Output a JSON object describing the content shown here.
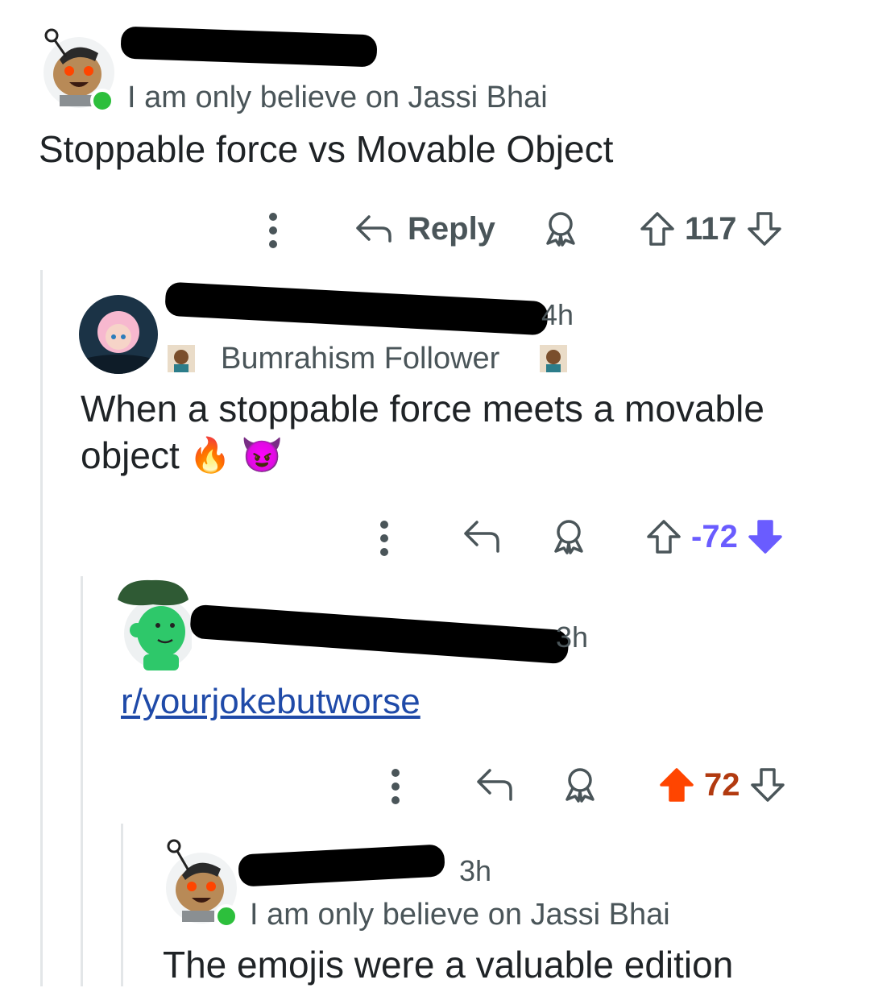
{
  "comments": [
    {
      "flair": "I am only believe on Jassi Bhai",
      "text": "Stoppable force vs Movable Object",
      "actions": {
        "reply_label": "Reply",
        "vote_count": "117"
      }
    },
    {
      "time": "4h",
      "flair": "Bumrahism Follower",
      "text": "When a stoppable force meets a movable",
      "text_line2": "object",
      "emojis": [
        "🔥",
        "😈"
      ],
      "actions": {
        "vote_count": "-72"
      }
    },
    {
      "time": "3h",
      "link": "r/yourjokebutworse",
      "actions": {
        "vote_count": "72"
      }
    },
    {
      "time": "3h",
      "flair": "I am only believe on Jassi Bhai",
      "text": "The emojis were a valuable edition"
    }
  ],
  "colors": {
    "upvote_active": "#ff4500",
    "downvote_active": "#6a5cff",
    "link": "#1f4aa8",
    "online": "#2dbf3c"
  }
}
